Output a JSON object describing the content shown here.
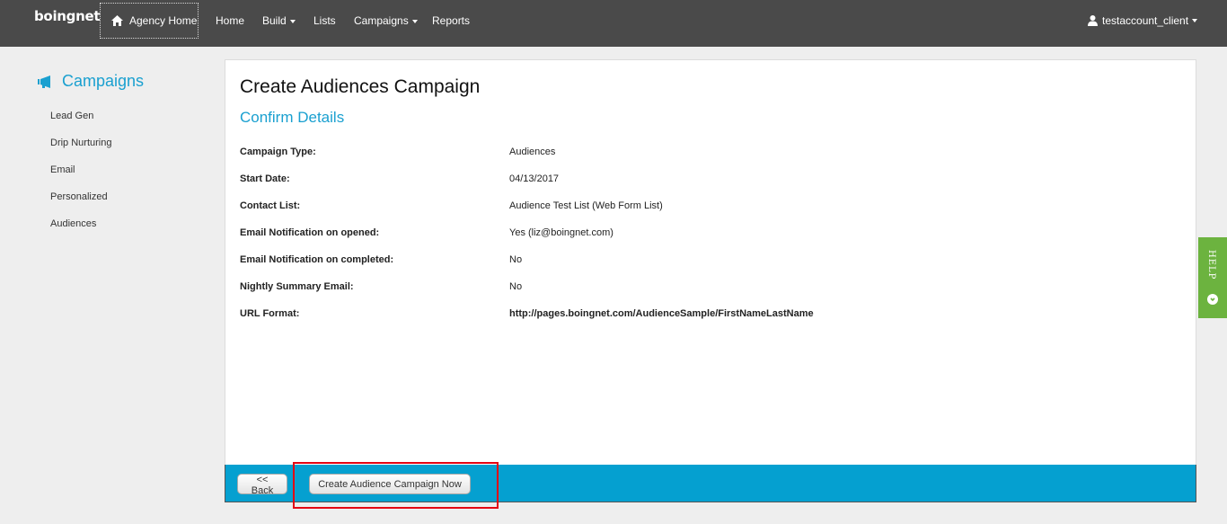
{
  "header": {
    "logo": "boingnet",
    "agency_home": "Agency Home",
    "nav": [
      {
        "label": "Home",
        "dropdown": false
      },
      {
        "label": "Build",
        "dropdown": true
      },
      {
        "label": "Lists",
        "dropdown": false
      },
      {
        "label": "Campaigns",
        "dropdown": true
      },
      {
        "label": "Reports",
        "dropdown": false
      }
    ],
    "user": "testaccount_client"
  },
  "sidebar": {
    "title": "Campaigns",
    "icon": "megaphone-icon",
    "items": [
      "Lead Gen",
      "Drip Nurturing",
      "Email",
      "Personalized",
      "Audiences"
    ]
  },
  "main": {
    "title": "Create Audiences Campaign",
    "subtitle": "Confirm Details",
    "details": [
      {
        "label": "Campaign Type:",
        "value": "Audiences"
      },
      {
        "label": "Start Date:",
        "value": "04/13/2017"
      },
      {
        "label": "Contact List:",
        "value": "Audience Test List (Web Form List)"
      },
      {
        "label": "Email Notification on opened:",
        "value": "Yes (liz@boingnet.com)"
      },
      {
        "label": "Email Notification on completed:",
        "value": "No"
      },
      {
        "label": "Nightly Summary Email:",
        "value": "No"
      },
      {
        "label": "URL Format:",
        "value": "http://pages.boingnet.com/AudienceSample/FirstNameLastName"
      }
    ]
  },
  "footer": {
    "back_label": "<< Back",
    "create_label": "Create Audience Campaign Now"
  },
  "help": {
    "label": "HELP"
  },
  "colors": {
    "topbar": "#4a4a4a",
    "accent": "#1aa0d0",
    "footer": "#05a0d0",
    "help": "#6cb33f",
    "highlight": "#e30613"
  }
}
